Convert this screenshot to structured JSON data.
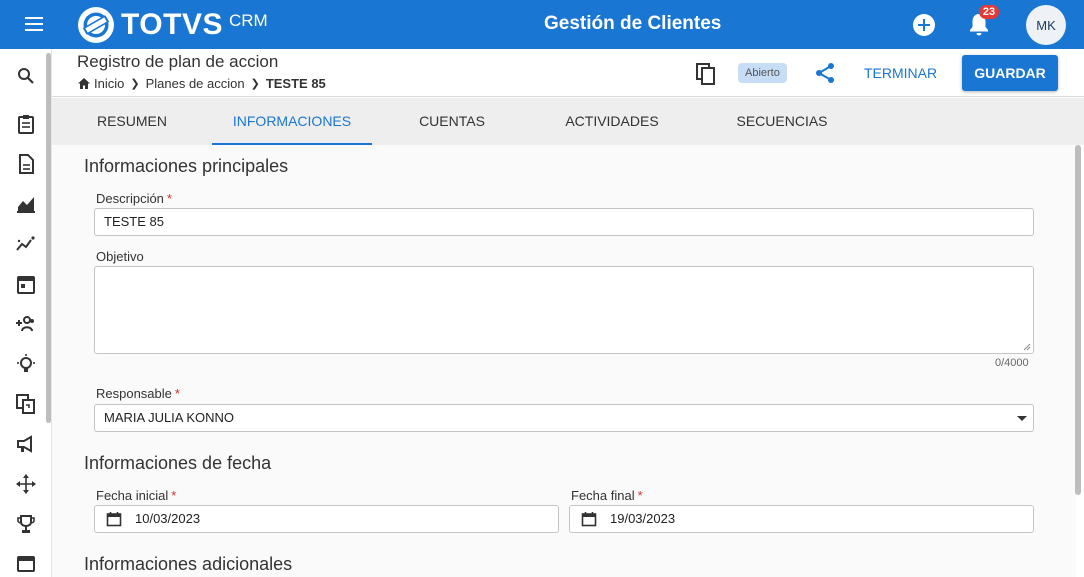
{
  "app": {
    "brand": "TOTVS",
    "product": "CRM",
    "title": "Gestión de Clientes",
    "notifications_count": "23",
    "user_initials": "MK",
    "accent": "#1976d2"
  },
  "header": {
    "page_title": "Registro de plan de accion",
    "breadcrumb": [
      "Inicio",
      "Planes de accion",
      "TESTE 85"
    ],
    "status": "Abierto",
    "terminar_label": "TERMINAR",
    "guardar_label": "GUARDAR"
  },
  "sidebar": {
    "icons": [
      "search-icon",
      "clipboard-icon",
      "document-icon",
      "area-chart-icon",
      "trend-chart-icon",
      "calendar-icon",
      "add-group-icon",
      "lightbulb-icon",
      "swap-documents-icon",
      "megaphone-icon",
      "move-arrows-icon",
      "trophy-icon",
      "window-icon"
    ]
  },
  "tabs": [
    {
      "label": "RESUMEN",
      "active": false
    },
    {
      "label": "INFORMACIONES",
      "active": true
    },
    {
      "label": "CUENTAS",
      "active": false
    },
    {
      "label": "ACTIVIDADES",
      "active": false
    },
    {
      "label": "SECUENCIAS",
      "active": false
    }
  ],
  "form": {
    "section_main": "Informaciones principales",
    "descripcion_label": "Descripción",
    "descripcion_value": "TESTE 85",
    "objetivo_label": "Objetivo",
    "objetivo_value": "",
    "objetivo_counter": "0/4000",
    "responsable_label": "Responsable",
    "responsable_value": "MARIA JULIA KONNO",
    "section_dates": "Informaciones de fecha",
    "fecha_inicial_label": "Fecha inicial",
    "fecha_inicial_value": "10/03/2023",
    "fecha_final_label": "Fecha final",
    "fecha_final_value": "19/03/2023",
    "section_additional": "Informaciones adicionales",
    "required_mark": "*"
  }
}
